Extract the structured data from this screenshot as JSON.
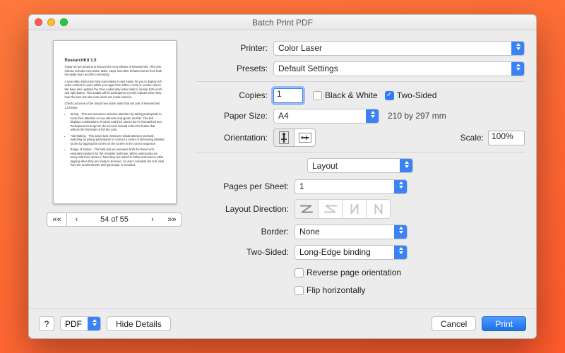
{
  "window": {
    "title": "Batch Print PDF"
  },
  "preview": {
    "doc_title": "ResearchKit 1.5",
    "para1": "Today we are proud to announce the next release of ResearchKit. This new release includes new active tasks, steps and other enhancements from both the Apple team and the community.",
    "para2": "A new video instruction step now makes it even easier for you to display rich video content to users within your apps from either a local or remote source. We have also updated the Tone Audiometry active task to include both a left and right button. This update will let participants not only indicate when they hear the tone but also note which ear it was heard in.",
    "para3": "Check out some of the brand new active tasks that are part of ResearchKit 1.5 below:",
    "bul1": "Stroop · This test measures selective attention by asking participants to focus their attention on one stimulus and ignore another. The test displays combinations of colors and their names but in mismatched text. Participants must ignore the text and instead select the button that reflects the first letter of the tint color.",
    "bul2": "Trail Making · This active task measures visual attention and task switching by asking participants to connect a series of alternating labelled circles by tapping the circles on the screen in the correct sequence.",
    "bul3": "Range of Motion · This task lets you measure both the flexed and extended positions for the shoulder and knee. When participants are ready with their device in hand they are asked to follow instructions while tapping when they are ready to proceed. As users complete the test, data from the accelerometer and gyroscope is recorded.",
    "page_indicator": "54 of 55"
  },
  "labels": {
    "printer": "Printer:",
    "presets": "Presets:",
    "copies": "Copies:",
    "black_white": "Black & White",
    "two_sided": "Two-Sided",
    "paper_size": "Paper Size:",
    "paper_dim": "210 by 297 mm",
    "orientation": "Orientation:",
    "scale": "Scale:",
    "section": "Layout",
    "pps": "Pages per Sheet:",
    "layout_dir": "Layout Direction:",
    "border": "Border:",
    "two_sided2": "Two-Sided:",
    "reverse": "Reverse page orientation",
    "flip": "Flip horizontally"
  },
  "values": {
    "printer": "Color Laser",
    "presets": "Default Settings",
    "copies": "1",
    "bw_checked": false,
    "two_sided_checked": true,
    "paper_size": "A4",
    "scale": "100%",
    "pps": "1",
    "border": "None",
    "two_sided_mode": "Long-Edge binding",
    "reverse_checked": false,
    "flip_checked": false
  },
  "footer": {
    "help": "?",
    "pdf": "PDF",
    "hide": "Hide Details",
    "cancel": "Cancel",
    "print": "Print"
  }
}
